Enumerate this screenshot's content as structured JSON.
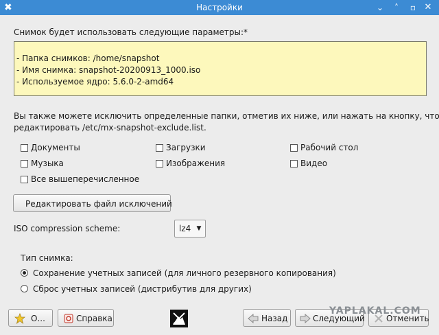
{
  "window": {
    "title": "Настройки",
    "controls": [
      "⌄",
      "˄",
      "▫",
      "✕"
    ]
  },
  "intro": "Снимок будет использовать следующие параметры:*",
  "params": [
    "- Папка снимков: /home/snapshot",
    "- Имя снимка: snapshot-20200913_1000.iso",
    "- Используемое ядро: 5.6.0-2-amd64"
  ],
  "exclude_text_line1": "Вы также можете исключить определенные папки, отметив их ниже, или нажать на кнопку, чтобы",
  "exclude_text_line2": "редактировать /etc/mx-snapshot-exclude.list.",
  "checkboxes": {
    "documents": {
      "label": "Документы",
      "checked": false
    },
    "downloads": {
      "label": "Загрузки",
      "checked": false
    },
    "desktop": {
      "label": "Рабочий стол",
      "checked": false
    },
    "music": {
      "label": "Музыка",
      "checked": false
    },
    "images": {
      "label": "Изображения",
      "checked": false
    },
    "video": {
      "label": "Видео",
      "checked": false
    },
    "all": {
      "label": "Все вышеперечисленное",
      "checked": false
    }
  },
  "edit_exclusions_button": "Редактировать файл исключений",
  "compression": {
    "label": "ISO compression scheme:",
    "value": "lz4"
  },
  "snapshot_type": {
    "label": "Тип снимка:",
    "options": [
      {
        "label": "Сохранение учетных записей (для личного резервного копирования)",
        "selected": true
      },
      {
        "label": "Сброс учетных записей (дистрибутив для других)",
        "selected": false
      }
    ]
  },
  "footer": {
    "about_button": "О...",
    "help_button": "Справка",
    "back_button": "Назад",
    "next_button": "Следующий",
    "cancel_button": "Отменить"
  },
  "watermark": "YAPLAKAL.COM"
}
